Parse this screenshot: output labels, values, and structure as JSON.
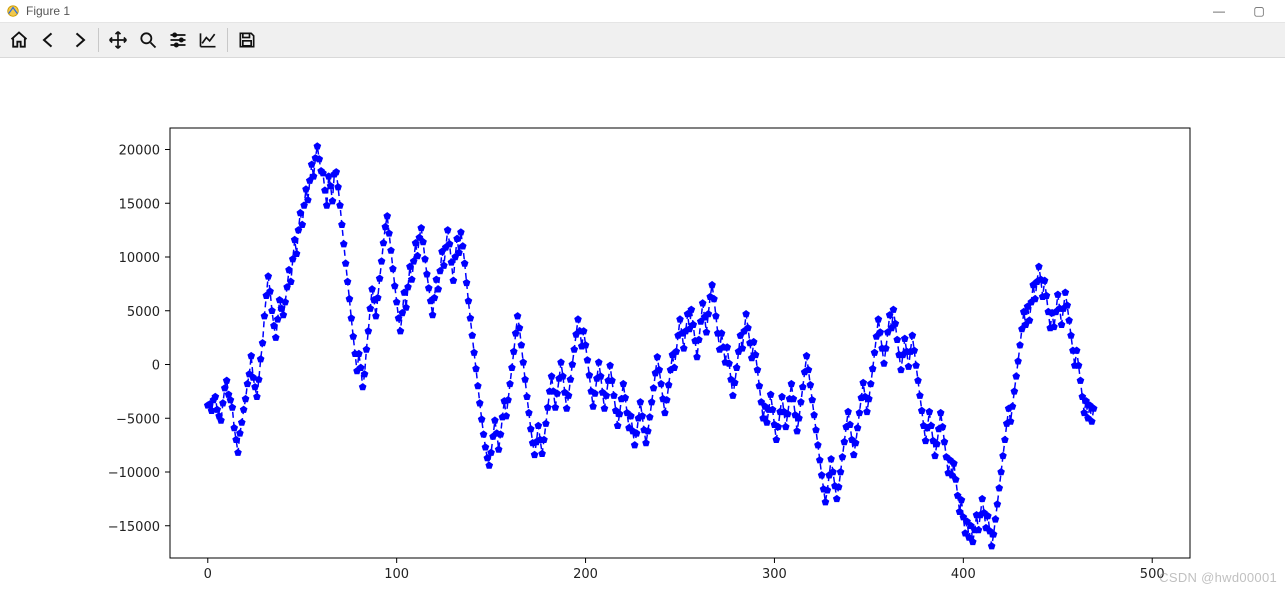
{
  "window": {
    "title": "Figure 1",
    "minimize": "—",
    "maximize": "▢"
  },
  "toolbar": {
    "home": "Home",
    "back": "Back",
    "forward": "Forward",
    "pan": "Pan",
    "zoom": "Zoom",
    "subplots": "Configure subplots",
    "axes": "Edit axes",
    "save": "Save"
  },
  "watermark": "CSDN @hwd00001",
  "chart_data": {
    "type": "line",
    "title": "",
    "xlabel": "",
    "ylabel": "",
    "xlim": [
      -20,
      520
    ],
    "ylim": [
      -18000,
      22000
    ],
    "xticks": [
      0,
      100,
      200,
      300,
      400,
      500
    ],
    "yticks": [
      -15000,
      -10000,
      -5000,
      0,
      5000,
      10000,
      15000,
      20000
    ],
    "series": [
      {
        "name": "series-0",
        "color": "#0000ff",
        "linestyle": "dashed",
        "marker": "pentagon",
        "x_start": 0,
        "x_step": 1,
        "values": [
          -3800,
          -3700,
          -4300,
          -3300,
          -3000,
          -4200,
          -4800,
          -5200,
          -3600,
          -2200,
          -1500,
          -2800,
          -3300,
          -4000,
          -5900,
          -7000,
          -8200,
          -6400,
          -5400,
          -4200,
          -3200,
          -1800,
          -900,
          800,
          -1200,
          -2100,
          -3000,
          -1400,
          500,
          2000,
          4500,
          6400,
          8200,
          6800,
          5000,
          3600,
          2500,
          4200,
          6000,
          5200,
          4600,
          5800,
          7200,
          8800,
          7700,
          9800,
          11600,
          10300,
          12500,
          14100,
          13000,
          14800,
          16300,
          15300,
          17100,
          18600,
          17500,
          19200,
          20300,
          19100,
          18000,
          17800,
          16200,
          14800,
          17500,
          16600,
          15200,
          17700,
          17900,
          16500,
          14800,
          13000,
          11200,
          9400,
          7700,
          6100,
          4300,
          2600,
          1000,
          -600,
          1000,
          -300,
          -2100,
          -900,
          1400,
          3100,
          5200,
          7000,
          6000,
          4500,
          6200,
          8000,
          9600,
          11300,
          12800,
          13800,
          12200,
          10600,
          8900,
          7300,
          5800,
          4300,
          3100,
          4800,
          6700,
          5300,
          7200,
          9100,
          7900,
          9600,
          11300,
          10100,
          11800,
          12700,
          11400,
          9800,
          8400,
          7100,
          5900,
          4600,
          6200,
          7900,
          7000,
          8700,
          10500,
          9200,
          10900,
          12500,
          11200,
          9500,
          7800,
          10000,
          11700,
          10400,
          12300,
          11000,
          9400,
          7600,
          5900,
          4300,
          2700,
          1100,
          -400,
          -2000,
          -3600,
          -5100,
          -6500,
          -7700,
          -8700,
          -9400,
          -8200,
          -6700,
          -5200,
          -6400,
          -7900,
          -6500,
          -4900,
          -3400,
          -4800,
          -3300,
          -1800,
          -300,
          1200,
          2900,
          4500,
          3400,
          1800,
          200,
          -1400,
          -3000,
          -4500,
          -6000,
          -7300,
          -8400,
          -7200,
          -5700,
          -7000,
          -8300,
          -7000,
          -5500,
          -4000,
          -2500,
          -1100,
          -2500,
          -4000,
          -2700,
          -1300,
          200,
          -1100,
          -2600,
          -4100,
          -2900,
          -1400,
          0,
          1400,
          2800,
          4200,
          3100,
          1700,
          3100,
          1800,
          400,
          -1000,
          -2500,
          -3900,
          -2700,
          -1300,
          200,
          -1100,
          -2600,
          -4100,
          -2900,
          -1500,
          -100,
          -1500,
          -2900,
          -4300,
          -5700,
          -4600,
          -3200,
          -1800,
          -3100,
          -4500,
          -5900,
          -4800,
          -6200,
          -7500,
          -6400,
          -5000,
          -3500,
          -4800,
          -6100,
          -7300,
          -6200,
          -4900,
          -3500,
          -2200,
          -800,
          700,
          -500,
          -1800,
          -3200,
          -4500,
          -3300,
          -1900,
          -500,
          900,
          -300,
          1200,
          2700,
          4200,
          2900,
          1500,
          3100,
          4700,
          3300,
          5100,
          3700,
          2200,
          700,
          2300,
          4000,
          5700,
          4400,
          3000,
          4700,
          6300,
          7400,
          6100,
          4500,
          2900,
          1400,
          2900,
          1600,
          200,
          1600,
          100,
          -1400,
          -2900,
          -1700,
          -300,
          1200,
          2700,
          1500,
          3100,
          4700,
          3400,
          2000,
          600,
          2100,
          900,
          -500,
          -2000,
          -3500,
          -5000,
          -3900,
          -5400,
          -4200,
          -2800,
          -4200,
          -5600,
          -7000,
          -5800,
          -4400,
          -3000,
          -4400,
          -5800,
          -4600,
          -3200,
          -1800,
          -3200,
          -4700,
          -6200,
          -5000,
          -3500,
          -2100,
          -700,
          800,
          -500,
          -1900,
          -3300,
          -4700,
          -6100,
          -7500,
          -8900,
          -10300,
          -11600,
          -12800,
          -11700,
          -10300,
          -8800,
          -10000,
          -11300,
          -12500,
          -11400,
          -10000,
          -8600,
          -7200,
          -5800,
          -4400,
          -5600,
          -7000,
          -8400,
          -7300,
          -5900,
          -4500,
          -3100,
          -1700,
          -3000,
          -4400,
          -3200,
          -1800,
          -400,
          1100,
          2600,
          4200,
          3000,
          1500,
          100,
          1500,
          3000,
          4600,
          3400,
          5100,
          3800,
          2300,
          900,
          -500,
          900,
          2400,
          1200,
          -200,
          1200,
          2700,
          1300,
          -100,
          -1500,
          -2900,
          -4300,
          -5700,
          -7100,
          -5900,
          -4400,
          -5700,
          -7100,
          -8500,
          -7400,
          -6000,
          -4500,
          -5800,
          -7200,
          -8600,
          -10100,
          -8900,
          -10300,
          -9200,
          -10700,
          -12200,
          -13700,
          -12600,
          -14200,
          -15700,
          -14600,
          -16100,
          -15000,
          -16500,
          -15400,
          -14000,
          -15400,
          -14000,
          -12500,
          -13800,
          -15200,
          -14100,
          -15500,
          -16900,
          -15800,
          -14400,
          -13000,
          -11500,
          -10000,
          -8500,
          -7000,
          -5500,
          -4100,
          -5300,
          -3900,
          -2500,
          -1100,
          300,
          1800,
          3300,
          4900,
          3700,
          5400,
          4100,
          5800,
          7400,
          6100,
          7700,
          9100,
          7900,
          6300,
          7800,
          6400,
          4900,
          3400,
          4800,
          3500,
          4900,
          6500,
          5200,
          3700,
          5200,
          6700,
          5500,
          4100,
          2700,
          1300,
          -100,
          1300,
          -100,
          -1500,
          -3000,
          -4500,
          -3400,
          -5000,
          -3800,
          -5300,
          -4100
        ]
      }
    ]
  }
}
